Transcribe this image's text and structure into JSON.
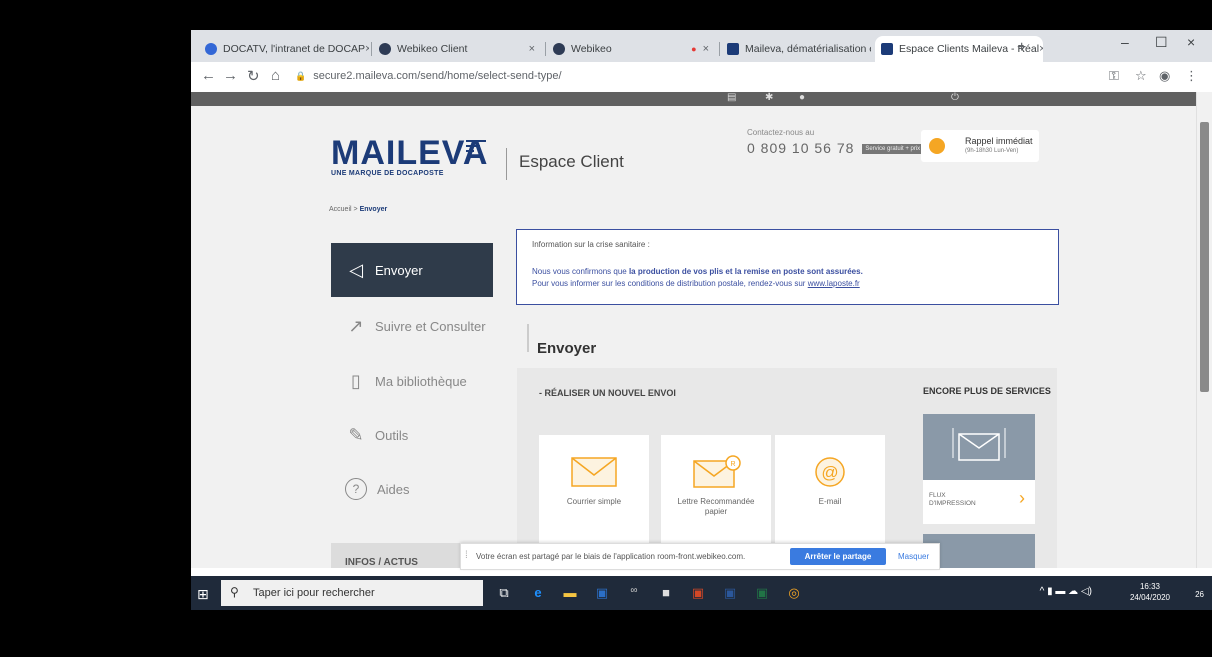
{
  "browser": {
    "tabs": [
      {
        "label": "DOCATV, l'intranet de DOCAP",
        "close": "×",
        "fav_color": "#3367d6"
      },
      {
        "label": "Webikeo Client",
        "close": "×",
        "fav_color": "#2e3b55"
      },
      {
        "label": "Webikeo",
        "close": "×",
        "fav_color": "#2e3b55"
      },
      {
        "label": "Maileva, dématérialisation et",
        "close": "×",
        "fav_color": "#1c3b78"
      },
      {
        "label": "Espace Clients Maileva - Réal",
        "close": "×",
        "fav_color": "#1c3b78"
      }
    ],
    "new_tab": "+",
    "window_controls": {
      "minimize": "–",
      "maximize": "☐",
      "close": "×"
    },
    "nav": {
      "back": "←",
      "forward": "→",
      "reload": "↻",
      "home": "⌂"
    },
    "url": "secure2.maileva.com/send/home/select-send-type/",
    "lock": "🔒"
  },
  "site": {
    "logo": {
      "name": "MAILEVA",
      "tagline": "UNE MARQUE DE DOCAPOSTE"
    },
    "section": "Espace Client",
    "contact": {
      "label": "Contactez-nous au",
      "phone": "0 809 10 56 78",
      "badge": "Service gratuit + prix appel"
    },
    "callback": {
      "title": "Rappel immédiat",
      "hours": "(9h-18h30 Lun-Ven)"
    },
    "breadcrumb": {
      "home": "Accueil",
      "sep": ">",
      "current": "Envoyer"
    }
  },
  "sidebar": {
    "items": [
      {
        "label": "Envoyer",
        "icon": "◁"
      },
      {
        "label": "Suivre et Consulter",
        "icon": "↗"
      },
      {
        "label": "Ma bibliothèque",
        "icon": "▯"
      },
      {
        "label": "Outils",
        "icon": "✎"
      },
      {
        "label": "Aides",
        "icon": "?"
      }
    ],
    "infos": "INFOS / ACTUS"
  },
  "info_box": {
    "heading": "Information sur la crise sanitaire :",
    "line1_pre": "Nous vous confirmons que ",
    "line1_bold": "la production de vos plis et la remise en poste sont assurées.",
    "line2_pre": "Pour vous informer sur les conditions de distribution postale, rendez-vous sur ",
    "line2_link": "www.laposte.fr"
  },
  "main": {
    "title": "Envoyer",
    "panel_heading": "- RÉALISER UN NOUVEL ENVOI",
    "options": [
      {
        "label": "Courrier simple"
      },
      {
        "label": "Lettre Recommandée papier"
      },
      {
        "label": "E-mail"
      }
    ],
    "more_heading": "ENCORE PLUS DE SERVICES",
    "flux_label": "FLUX D'IMPRESSION"
  },
  "share_bar": {
    "message": "Votre écran est partagé par le biais de l'application room-front.webikeo.com.",
    "stop": "Arrêter le partage",
    "hide": "Masquer"
  },
  "taskbar": {
    "search_placeholder": "Taper ici pour rechercher",
    "time": "16:33",
    "date": "24/04/2020",
    "notif_count": "26"
  },
  "colors": {
    "brand": "#1c3b78",
    "accent": "#f5a623",
    "active_nav": "#2f3b4a",
    "share_button": "#3a7be0"
  }
}
